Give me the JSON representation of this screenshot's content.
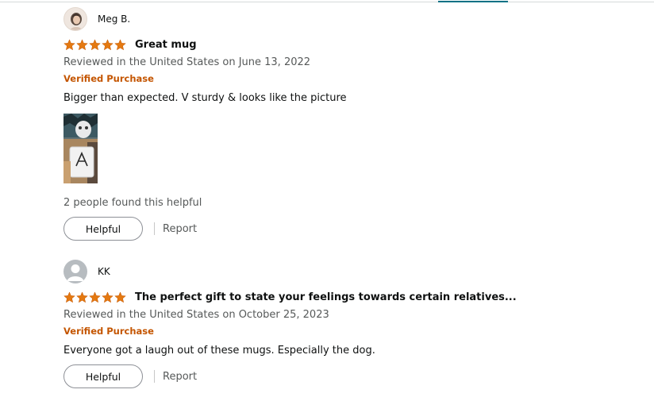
{
  "colors": {
    "star": "#e47911",
    "verified": "#c45500",
    "meta": "#565959",
    "accent": "#007185"
  },
  "reviews": [
    {
      "profile_name": "Meg B.",
      "avatar_icon": "profile-photo-avatar",
      "rating": 5,
      "title": "Great mug",
      "meta": "Reviewed in the United States on June 13, 2022",
      "verified": "Verified Purchase",
      "body": "Bigger than expected. V sturdy & looks like the picture",
      "helpful_count": "2 people found this helpful",
      "helpful_label": "Helpful",
      "report_label": "Report"
    },
    {
      "profile_name": "KK",
      "avatar_icon": "default-user-icon",
      "rating": 5,
      "title": "The perfect gift to state your feelings towards certain relatives...",
      "meta": "Reviewed in the United States on October 25, 2023",
      "verified": "Verified Purchase",
      "body": "Everyone got a laugh out of these mugs. Especially the dog.",
      "helpful_label": "Helpful",
      "report_label": "Report"
    }
  ]
}
